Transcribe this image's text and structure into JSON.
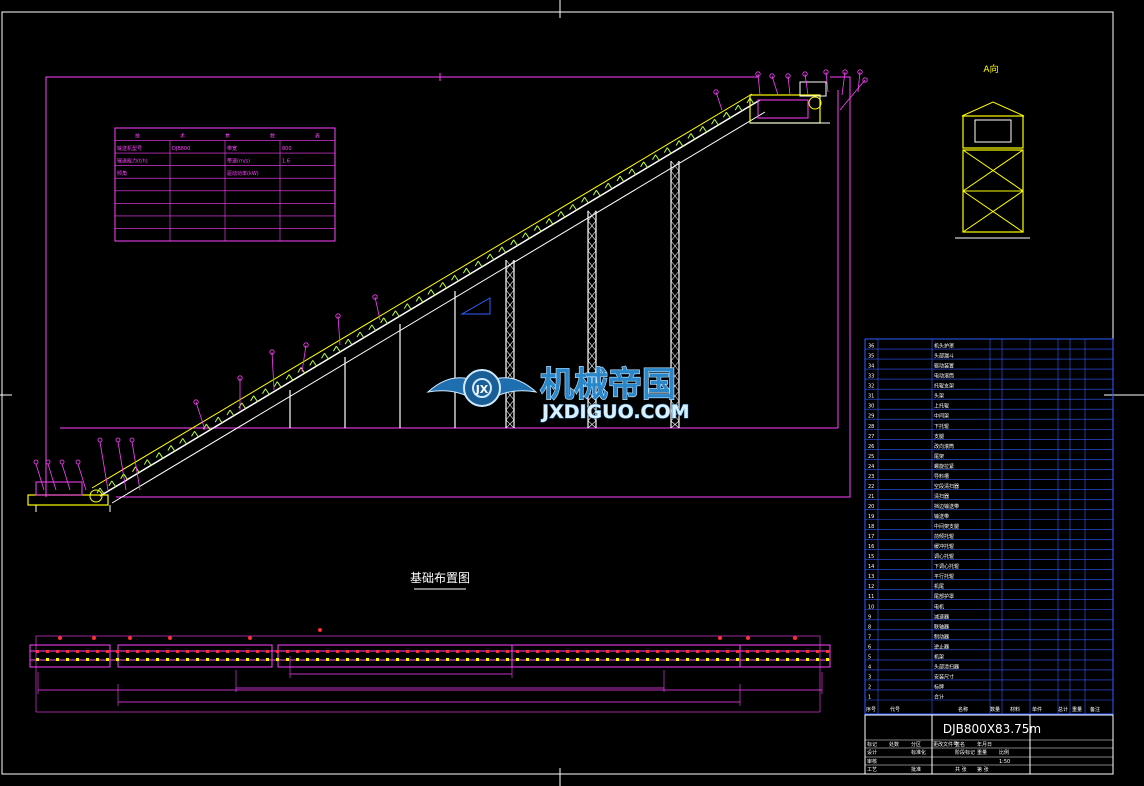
{
  "drawing": {
    "layout_title": "基础布置图",
    "model_title": "DJB800X83.75m",
    "side_view_label": "A向",
    "colors": {
      "background": "#000000",
      "frame": "#ffffff",
      "magenta": "#ff40ff",
      "yellow": "#ffff00",
      "green": "#b8ff40",
      "blue": "#2f5bff",
      "red": "#ff3030"
    }
  },
  "parameter_table": {
    "header": [
      "技",
      "术",
      "参",
      "数",
      "表"
    ],
    "rows": [
      [
        "输送机型号",
        "DJB800",
        "带宽",
        "800"
      ],
      [
        "输送能力(t/h)",
        "",
        "带速(m/s)",
        "1.6"
      ],
      [
        "倾角",
        "",
        "驱动功率(kW)",
        ""
      ],
      [
        "",
        "",
        "",
        ""
      ],
      [
        "",
        "",
        "",
        ""
      ],
      [
        "",
        "",
        "",
        ""
      ],
      [
        "",
        "",
        "",
        ""
      ],
      [
        "",
        "",
        "",
        ""
      ]
    ]
  },
  "parts_list": {
    "header": [
      "序号",
      "代号",
      "名称",
      "数量",
      "材料",
      "单件",
      "总计",
      "重量",
      "备注"
    ],
    "items": [
      "机头护罩",
      "头部漏斗",
      "驱动装置",
      "电动滚筒",
      "托辊支架",
      "头架",
      "上托辊",
      "中间架",
      "下托辊",
      "支腿",
      "改向滚筒",
      "尾架",
      "螺旋拉紧",
      "导料槽",
      "空段清扫器",
      "清扫器",
      "挡边输送带",
      "输送带",
      "中间架支腿",
      "前倾托辊",
      "缓冲托辊",
      "调心托辊",
      "下调心托辊",
      "平行托辊",
      "机尾",
      "尾部护罩",
      "电机",
      "减速器",
      "联轴器",
      "制动器",
      "逆止器",
      "机架",
      "头部清扫器",
      "安装尺寸",
      "标牌",
      "合计"
    ]
  },
  "title_block": {
    "row1": [
      "标记",
      "处数",
      "分区",
      "更改文件号",
      "签名",
      "年月日"
    ],
    "row2": [
      "设计",
      "",
      "标准化",
      "",
      "阶段标记",
      "重量",
      "比例"
    ],
    "row3": [
      "审核",
      "",
      "",
      "",
      "",
      "",
      "1:50"
    ],
    "row4": [
      "工艺",
      "",
      "批准",
      "",
      "共 张",
      "第 张"
    ]
  },
  "watermark": {
    "cn": "机械帝国",
    "en": "JXDIGUO.COM"
  }
}
